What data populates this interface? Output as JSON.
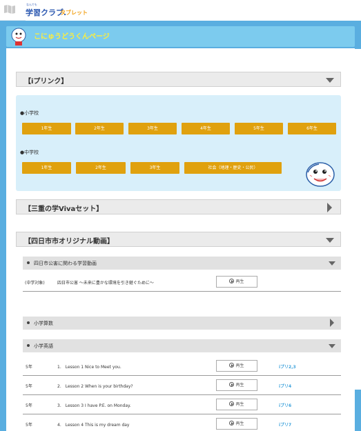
{
  "app": {
    "logo_small": "なんでも",
    "logo_main": "学習クラブ.",
    "logo_sub": "タブレット"
  },
  "header": {
    "title": "こにゅうどうくんページ"
  },
  "iprint": {
    "title": "【iプリンク】",
    "elementary_label": "●小学校",
    "elementary_grades": [
      "1年生",
      "2年生",
      "3年生",
      "4年生",
      "5年生",
      "6年生"
    ],
    "junior_label": "●中学校",
    "junior_grades": [
      "1年生",
      "2年生",
      "3年生"
    ],
    "junior_social": "社会（地理・歴史・公民）"
  },
  "viva": {
    "title": "【三重の学Vivaセット】"
  },
  "yokkaichi": {
    "title": "【四日市市オリジナル動画】",
    "pollution": {
      "title": "四日市公害に関わる学習動画",
      "row": {
        "grade": "(中学対象)",
        "title": "四日市公害 ～未来に豊かな環境を引き継ぐために～",
        "play": "再生"
      }
    },
    "math": {
      "title": "小学算数"
    },
    "english": {
      "title": "小学英語",
      "rows": [
        {
          "grade": "5年",
          "title": "1.　Lesson 1 Nice to Meet you.",
          "play": "再生",
          "link": "iプリ2,3"
        },
        {
          "grade": "5年",
          "title": "2.　Lesson 2 When is your birthday?",
          "play": "再生",
          "link": "iプリ4"
        },
        {
          "grade": "5年",
          "title": "3.　Lesson 3 I have P.E. on Monday.",
          "play": "再生",
          "link": "iプリ6"
        },
        {
          "grade": "5年",
          "title": "4.　Lesson 4 This is my dream day",
          "play": "再生",
          "link": "iプリ7"
        }
      ]
    }
  },
  "colors": {
    "accent": "#5aaee0",
    "button": "#e0a10e",
    "link": "#3fa3dc",
    "title_text": "#ffee3a"
  }
}
